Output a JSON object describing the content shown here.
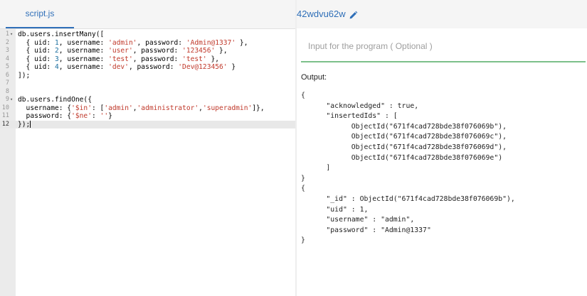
{
  "editor": {
    "tab_label": "script.js",
    "lines": [
      {
        "num": "1",
        "fold": "▾",
        "parts": [
          [
            "t",
            "db.users.insertMany(["
          ]
        ]
      },
      {
        "num": "2",
        "fold": "",
        "parts": [
          [
            "t",
            "  { uid: "
          ],
          [
            "n",
            "1"
          ],
          [
            "t",
            ", username: "
          ],
          [
            "s",
            "'admin'"
          ],
          [
            "t",
            ", password: "
          ],
          [
            "s",
            "'Admin@1337'"
          ],
          [
            "t",
            " },"
          ]
        ]
      },
      {
        "num": "3",
        "fold": "",
        "parts": [
          [
            "t",
            "  { uid: "
          ],
          [
            "n",
            "2"
          ],
          [
            "t",
            ", username: "
          ],
          [
            "s",
            "'user'"
          ],
          [
            "t",
            ", password: "
          ],
          [
            "s",
            "'123456'"
          ],
          [
            "t",
            " },"
          ]
        ]
      },
      {
        "num": "4",
        "fold": "",
        "parts": [
          [
            "t",
            "  { uid: "
          ],
          [
            "n",
            "3"
          ],
          [
            "t",
            ", username: "
          ],
          [
            "s",
            "'test'"
          ],
          [
            "t",
            ", password: "
          ],
          [
            "s",
            "'test'"
          ],
          [
            "t",
            " },"
          ]
        ]
      },
      {
        "num": "5",
        "fold": "",
        "parts": [
          [
            "t",
            "  { uid: "
          ],
          [
            "n",
            "4"
          ],
          [
            "t",
            ", username: "
          ],
          [
            "s",
            "'dev'"
          ],
          [
            "t",
            ", password: "
          ],
          [
            "s",
            "'Dev@123456'"
          ],
          [
            "t",
            " }"
          ]
        ]
      },
      {
        "num": "6",
        "fold": "",
        "parts": [
          [
            "t",
            "]);"
          ]
        ]
      },
      {
        "num": "7",
        "fold": "",
        "parts": []
      },
      {
        "num": "8",
        "fold": "",
        "parts": []
      },
      {
        "num": "9",
        "fold": "▾",
        "parts": [
          [
            "t",
            "db.users.findOne({"
          ]
        ]
      },
      {
        "num": "10",
        "fold": "",
        "parts": [
          [
            "t",
            "  username: {"
          ],
          [
            "s",
            "'$in'"
          ],
          [
            "t",
            ": ["
          ],
          [
            "s",
            "'admin'"
          ],
          [
            "t",
            ","
          ],
          [
            "s",
            "'administrator'"
          ],
          [
            "t",
            ","
          ],
          [
            "s",
            "'superadmin'"
          ],
          [
            "t",
            "]},"
          ]
        ]
      },
      {
        "num": "11",
        "fold": "",
        "parts": [
          [
            "t",
            "  password: {"
          ],
          [
            "s",
            "'$ne'"
          ],
          [
            "t",
            ": "
          ],
          [
            "s",
            "''"
          ],
          [
            "t",
            "}"
          ]
        ]
      },
      {
        "num": "12",
        "fold": "",
        "parts": [
          [
            "t",
            "});"
          ]
        ],
        "active": true
      }
    ]
  },
  "snippet": {
    "name": "42wdvu62w",
    "edit_icon": "pencil-icon"
  },
  "stdin": {
    "placeholder": "Input for the program ( Optional )",
    "value": ""
  },
  "output": {
    "label": "Output:",
    "text": "{\n\t\"acknowledged\" : true,\n\t\"insertedIds\" : [\n\t\tObjectId(\"671f4cad728bde38f076069b\"),\n\t\tObjectId(\"671f4cad728bde38f076069c\"),\n\t\tObjectId(\"671f4cad728bde38f076069d\"),\n\t\tObjectId(\"671f4cad728bde38f076069e\")\n\t]\n}\n{\n\t\"_id\" : ObjectId(\"671f4cad728bde38f076069b\"),\n\t\"uid\" : 1,\n\t\"username\" : \"admin\",\n\t\"password\" : \"Admin@1337\"\n}"
  },
  "colors": {
    "accent": "#2f6fb8",
    "input_underline": "#7cc08a",
    "string": "#c0392b",
    "number": "#1c6f9f"
  }
}
